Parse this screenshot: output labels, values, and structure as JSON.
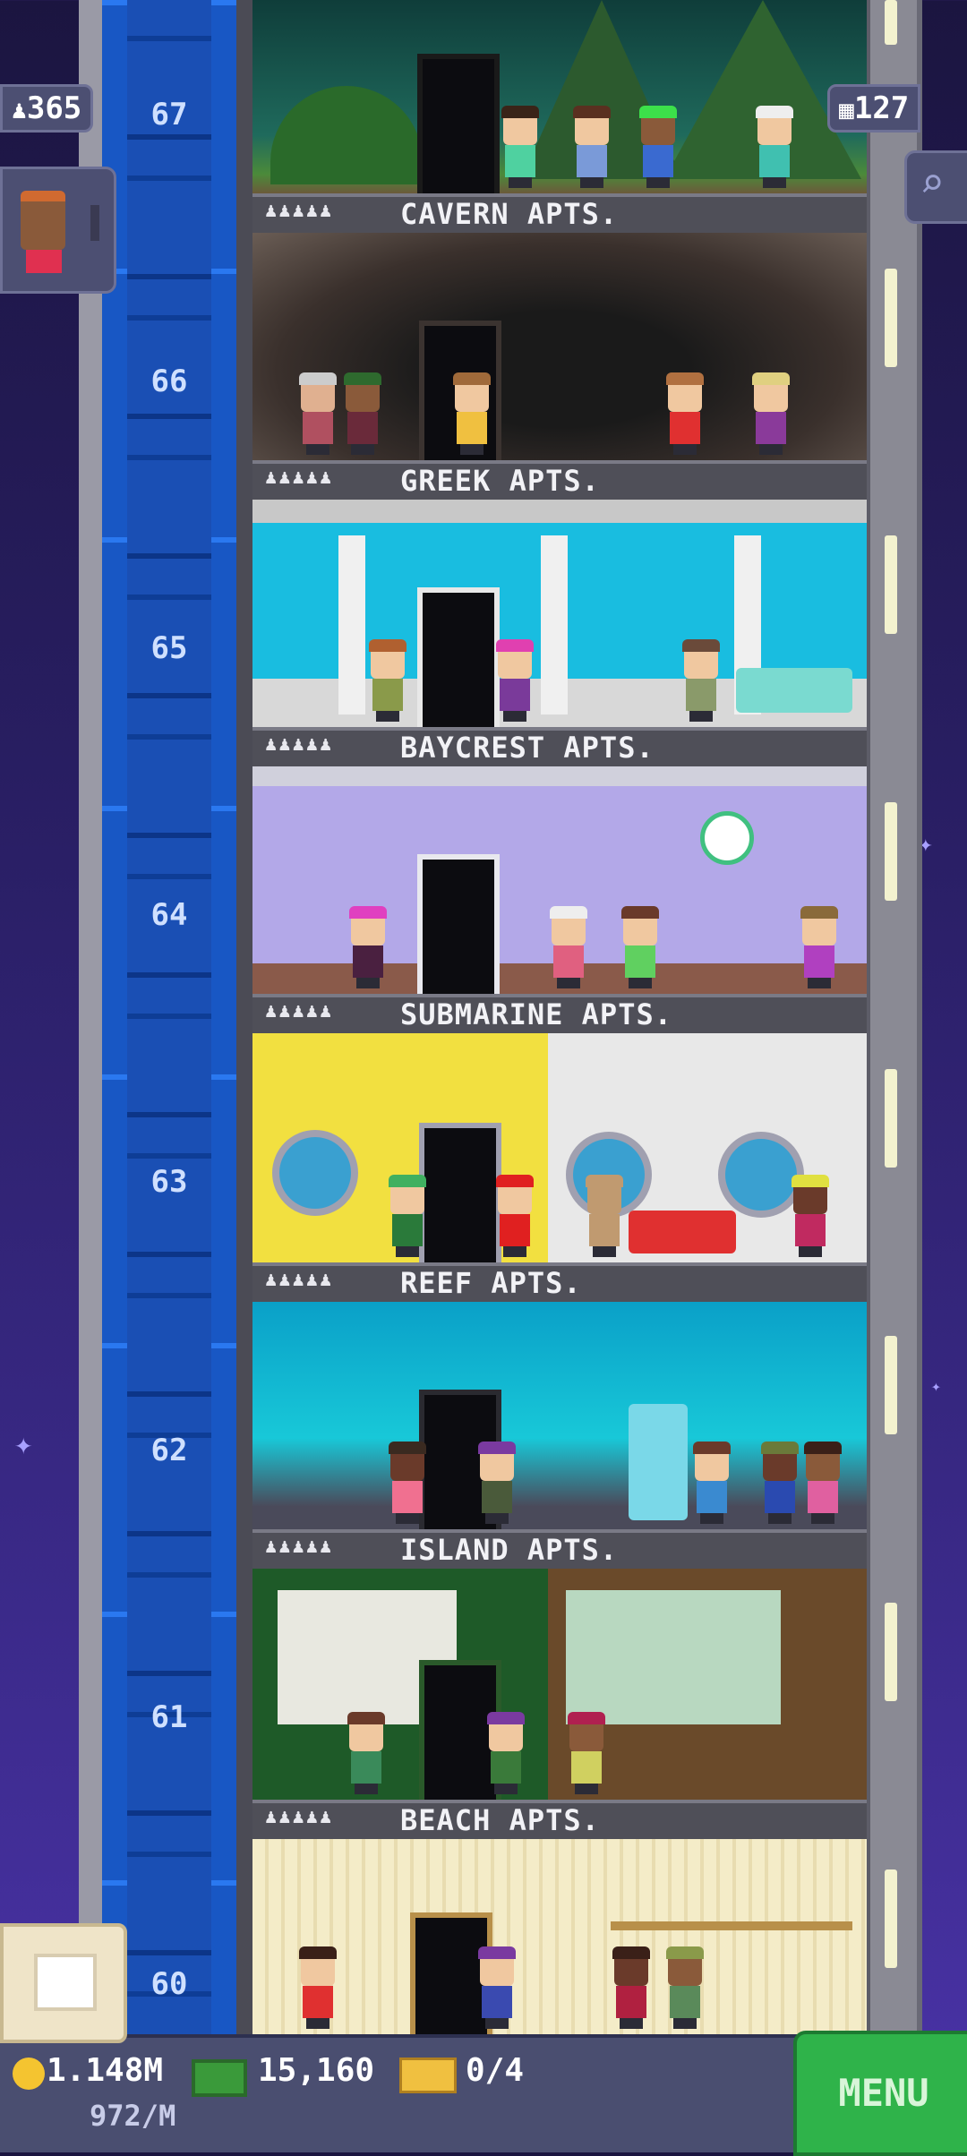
{
  "hud": {
    "population": "365",
    "floors": "127",
    "coins": "1.148M",
    "coin_rate": "972/M",
    "bux": "15,160",
    "tickets": "0/4",
    "menu_label": "MENU"
  },
  "floors": [
    {
      "number": "67",
      "name": ""
    },
    {
      "number": "66",
      "name": "CAVERN APTS."
    },
    {
      "number": "65",
      "name": "GREEK APTS."
    },
    {
      "number": "64",
      "name": "BAYCREST APTS."
    },
    {
      "number": "63",
      "name": "SUBMARINE APTS."
    },
    {
      "number": "62",
      "name": "REEF APTS."
    },
    {
      "number": "61",
      "name": "ISLAND APTS."
    },
    {
      "number": "60",
      "name": "BEACH APTS."
    }
  ],
  "label_stars": "♟♟♟♟♟",
  "colors": {
    "elevator": "#1f63d6",
    "menu": "#2fb34a",
    "sky": "#2a1f66"
  }
}
